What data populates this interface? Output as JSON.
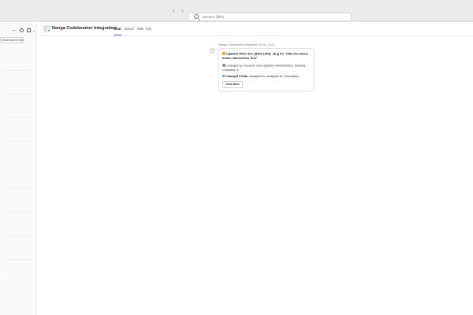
{
  "titlebar": {
    "search_placeholder": "Suchen (⌘E)",
    "back_icon": "chevron-left-icon",
    "forward_icon": "chevron-right-icon"
  },
  "sidebar": {
    "chip_label": "Geschlossen/Vorgelesen"
  },
  "header": {
    "app_name": "Nanga Codebeamer Integration",
    "tabs": [
      {
        "label": "Chat",
        "active": true
      },
      {
        "label": "Board",
        "active": false
      },
      {
        "label": "Wiki",
        "active": false
      },
      {
        "label": "Info",
        "active": false
      }
    ]
  },
  "message": {
    "sender": "Nanga Codebeamer Integration",
    "time": "16:36, 13.01.",
    "title": "Updated Work Item [BUG-1064] - Bug for \"Hide Directions before intersection Test\"",
    "changed_by": "Changed by: Account: bond (System Administrator, Default) Company: A",
    "changed_fields_label": "Changed Fields:",
    "changed_fields_value": "Assigned to, Assigned at, Description",
    "view_button": "View Item"
  },
  "colors": {
    "accent": "#5b5fc7",
    "presence_online": "#2e9e4f"
  }
}
